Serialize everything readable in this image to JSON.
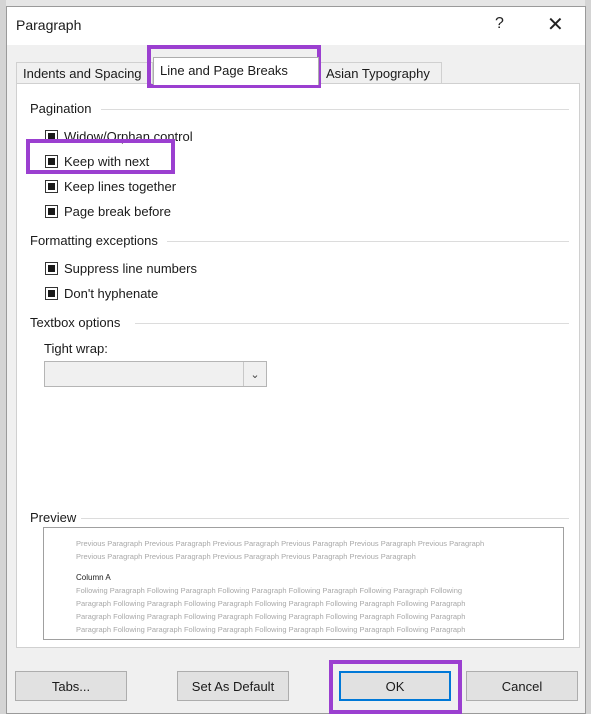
{
  "dialog": {
    "title": "Paragraph",
    "help_label": "?",
    "close_label": "✕"
  },
  "tabs": [
    {
      "label": "Indents and Spacing",
      "active": false
    },
    {
      "label": "Line and Page Breaks",
      "active": true
    },
    {
      "label": "Asian Typography",
      "active": false
    }
  ],
  "pagination": {
    "heading": "Pagination",
    "options": [
      {
        "label": "Widow/Orphan control",
        "checked": "indeterminate"
      },
      {
        "label": "Keep with next",
        "checked": "indeterminate"
      },
      {
        "label": "Keep lines together",
        "checked": "indeterminate"
      },
      {
        "label": "Page break before",
        "checked": "indeterminate"
      }
    ]
  },
  "formatting": {
    "heading": "Formatting exceptions",
    "options": [
      {
        "label": "Suppress line numbers",
        "checked": "indeterminate"
      },
      {
        "label": "Don't hyphenate",
        "checked": "indeterminate"
      }
    ]
  },
  "textbox": {
    "heading": "Textbox options",
    "tight_wrap_label": "Tight wrap:",
    "tight_wrap_value": ""
  },
  "preview": {
    "heading": "Preview",
    "previous_lines": [
      "Previous Paragraph Previous Paragraph Previous Paragraph Previous Paragraph Previous Paragraph Previous Paragraph",
      "Previous Paragraph Previous Paragraph Previous Paragraph Previous Paragraph Previous Paragraph"
    ],
    "sample_text": "Column A",
    "following_lines": [
      "Following Paragraph Following Paragraph Following Paragraph Following Paragraph Following Paragraph Following",
      "Paragraph Following Paragraph Following Paragraph Following Paragraph Following Paragraph Following Paragraph",
      "Paragraph Following Paragraph Following Paragraph Following Paragraph Following Paragraph Following Paragraph",
      "Paragraph Following Paragraph Following Paragraph Following Paragraph Following Paragraph Following Paragraph"
    ]
  },
  "buttons": {
    "tabs": "Tabs...",
    "set_default": "Set As Default",
    "ok": "OK",
    "cancel": "Cancel"
  },
  "colors": {
    "highlight": "#9b3fd0",
    "default_button_border": "#0078d7"
  }
}
